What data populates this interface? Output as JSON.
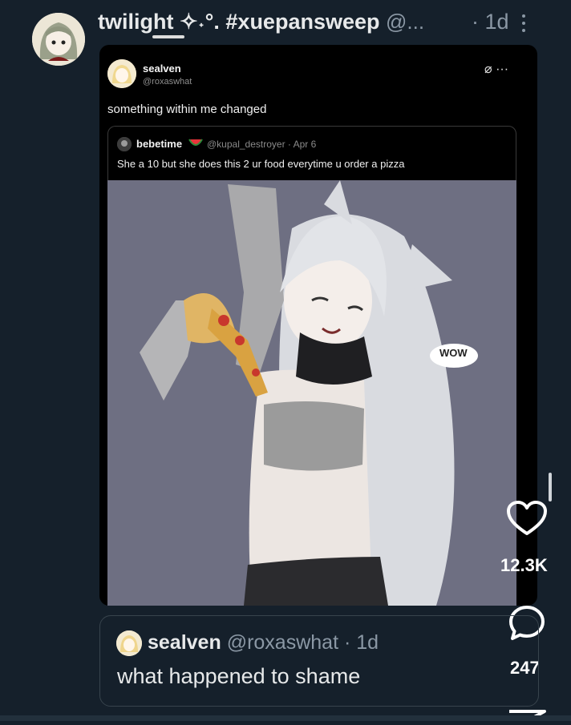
{
  "header": {
    "display_name": "twilight ✧˖°.",
    "hashtag": "#xuepansweep",
    "handle_trunc": "@...",
    "time": "· 1d"
  },
  "quoted_screenshot": {
    "author_name": "sealven",
    "author_handle": "@roxaswhat",
    "icons": "⌀ ···",
    "text": "something within me changed",
    "inner_quote": {
      "author_name": "bebetime",
      "emoji_icon": "watermelon-icon",
      "handle_time": "@kupal_destroyer · Apr 6",
      "text": "She a 10 but she does this 2 ur food everytime u order a pizza"
    },
    "art_speech": "WOW"
  },
  "actions": {
    "like_count": "12.3K",
    "reply_count": "247"
  },
  "bottom_quote": {
    "author_name": "sealven",
    "handle_time": "@roxaswhat · 1d",
    "text": "what happened to shame"
  },
  "colors": {
    "background": "#15202b",
    "text_primary": "#e7e9ea",
    "text_secondary": "#8b98a5"
  }
}
